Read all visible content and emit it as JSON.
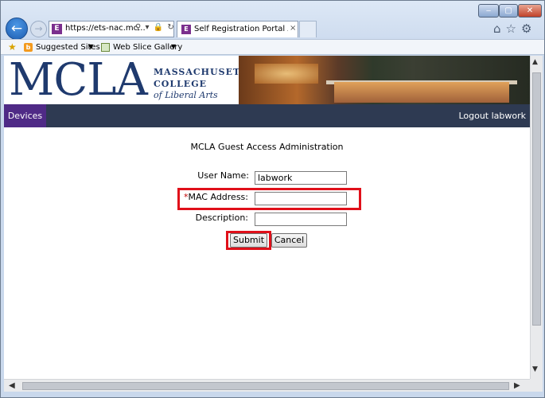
{
  "browser": {
    "address": "https://ets-nac.mc...",
    "address_icons": "⚲ ▾ 🔒 ↻",
    "tab_title": "Self Registration Portal Add...",
    "tab_close": "×",
    "favorites": {
      "suggested_sites": "Suggested Sites",
      "web_slice_gallery": "Web Slice Gallery"
    },
    "icons": [
      "back-arrow-icon",
      "forward-arrow-icon",
      "search-icon",
      "lock-icon",
      "refresh-icon",
      "home-icon",
      "star-icon",
      "gear-icon"
    ]
  },
  "site": {
    "logo_big": "MCLA",
    "logo_line1": "MASSACHUSETTS",
    "logo_line2": "COLLEGE",
    "logo_line3": "of Liberal Arts",
    "nav_devices": "Devices",
    "nav_logout": "Logout labwork"
  },
  "form": {
    "heading": "MCLA Guest Access Administration",
    "user_label": "User Name:",
    "user_value": "labwork",
    "mac_required_mark": "*",
    "mac_label": "MAC Address:",
    "mac_value": "",
    "desc_label": "Description:",
    "desc_value": "",
    "submit": "Submit",
    "cancel": "Cancel"
  },
  "colors": {
    "highlight": "#e0101a",
    "nav_bar": "#2e3a52",
    "nav_active": "#4f2a86",
    "brand_blue": "#1f3a6e"
  }
}
